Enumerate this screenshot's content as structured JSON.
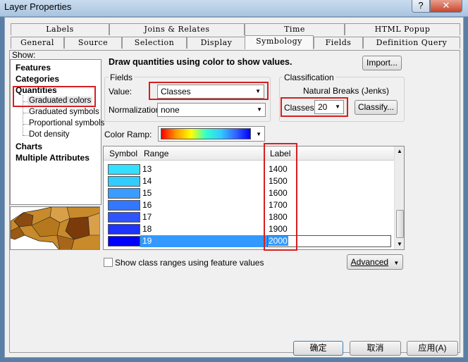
{
  "window": {
    "title": "Layer Properties",
    "help_label": "?",
    "close_label": "✕"
  },
  "tabs_back": [
    "Labels",
    "Joins & Relates",
    "Time",
    "HTML Popup"
  ],
  "tabs_front": [
    "General",
    "Source",
    "Selection",
    "Display",
    "Symbology",
    "Fields",
    "Definition Query"
  ],
  "show": {
    "label": "Show:",
    "items": [
      {
        "label": "Features",
        "level": 0
      },
      {
        "label": "Categories",
        "level": 0
      },
      {
        "label": "Quantities",
        "level": 0
      },
      {
        "label": "Graduated colors",
        "level": 1
      },
      {
        "label": "Graduated symbols",
        "level": 1
      },
      {
        "label": "Proportional symbols",
        "level": 1
      },
      {
        "label": "Dot density",
        "level": 1
      },
      {
        "label": "Charts",
        "level": 0
      },
      {
        "label": "Multiple Attributes",
        "level": 0
      }
    ]
  },
  "description": "Draw quantities using color to show values.",
  "import_label": "Import...",
  "fields": {
    "group_title": "Fields",
    "value_label": "Value:",
    "value": "Classes",
    "normalization_label": "Normalization:",
    "normalization": "none"
  },
  "classification": {
    "group_title": "Classification",
    "method": "Natural Breaks (Jenks)",
    "classes_label": "Classes:",
    "classes": "20",
    "classify_label": "Classify..."
  },
  "color_ramp_label": "Color Ramp:",
  "table": {
    "headers": {
      "symbol": "Symbol",
      "range": "Range",
      "label": "Label"
    },
    "rows": [
      {
        "range": "13",
        "label": "1400",
        "color": "#33e0ff"
      },
      {
        "range": "14",
        "label": "1500",
        "color": "#33ccff"
      },
      {
        "range": "15",
        "label": "1600",
        "color": "#3a9cff"
      },
      {
        "range": "16",
        "label": "1700",
        "color": "#3377ff"
      },
      {
        "range": "17",
        "label": "1800",
        "color": "#2f55ff"
      },
      {
        "range": "18",
        "label": "1900",
        "color": "#1f33ff"
      },
      {
        "range": "19",
        "label": "2000",
        "color": "#0000ff"
      }
    ]
  },
  "show_ranges_label": "Show class ranges using feature values",
  "advanced_label": "Advanced",
  "buttons": {
    "ok": "确定",
    "cancel": "取消",
    "apply": "应用(A)"
  }
}
